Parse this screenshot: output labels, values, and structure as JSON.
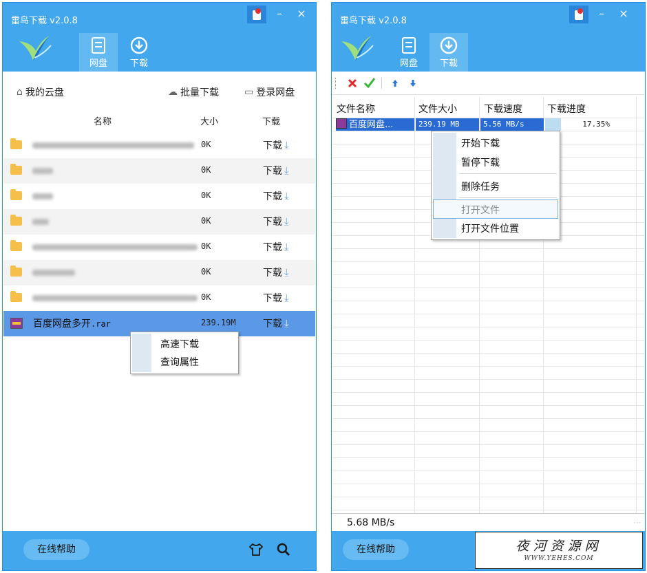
{
  "left": {
    "title": "雷鸟下载 v2.0.8",
    "window_controls": {
      "skin": "skin-icon",
      "minimize": "–",
      "close": "×"
    },
    "nav": [
      {
        "label": "网盘",
        "icon": "disk-icon",
        "active": true
      },
      {
        "label": "下载",
        "icon": "download-circle-icon",
        "active": false
      }
    ],
    "crumb": {
      "my_cloud": "我的云盘",
      "batch_download": "批量下载",
      "login_disk": "登录网盘"
    },
    "columns": {
      "name": "名称",
      "size": "大小",
      "download": "下载"
    },
    "rows": [
      {
        "size": "0K",
        "action": "下载"
      },
      {
        "size": "0K",
        "action": "下载"
      },
      {
        "size": "0K",
        "action": "下载"
      },
      {
        "size": "0K",
        "action": "下载"
      },
      {
        "size": "0K",
        "action": "下载"
      },
      {
        "size": "0K",
        "action": "下载"
      },
      {
        "size": "0K",
        "action": "下载"
      }
    ],
    "selected_file": {
      "name": "百度网盘多开",
      "ext": ".rar",
      "size": "239.19M",
      "action": "下载"
    },
    "context_menu": [
      "高速下载",
      "查询属性"
    ],
    "help_button": "在线帮助"
  },
  "right": {
    "title": "雷鸟下载 v2.0.8",
    "window_controls": {
      "skin": "skin-icon",
      "minimize": "–",
      "close": "×"
    },
    "nav": [
      {
        "label": "网盘",
        "icon": "disk-icon",
        "active": false
      },
      {
        "label": "下载",
        "icon": "download-circle-icon",
        "active": true
      }
    ],
    "toolbar": [
      "delete-icon",
      "check-icon",
      "up-icon",
      "down-icon"
    ],
    "columns": {
      "name": "文件名称",
      "size": "文件大小",
      "speed": "下载速度",
      "progress": "下载进度"
    },
    "task": {
      "name": "百度网盘...",
      "size": "239.19 MB",
      "speed": "5.56 MB/s",
      "progress": "17.35%",
      "progress_value": 17.35
    },
    "context_menu": [
      "开始下载",
      "暂停下载",
      "删除任务",
      "打开文件",
      "打开文件位置"
    ],
    "status_speed": "5.68 MB/s",
    "help_button": "在线帮助"
  },
  "watermark": {
    "cn": "夜河资源网",
    "url": "WWW.YEHES.COM"
  },
  "colors": {
    "header": "#42a7ec",
    "active_tab": "#64b9f1",
    "selected_row": "#5b98e6",
    "help_button": "#65bbf2",
    "menu_gutter": "#dde8f2"
  }
}
